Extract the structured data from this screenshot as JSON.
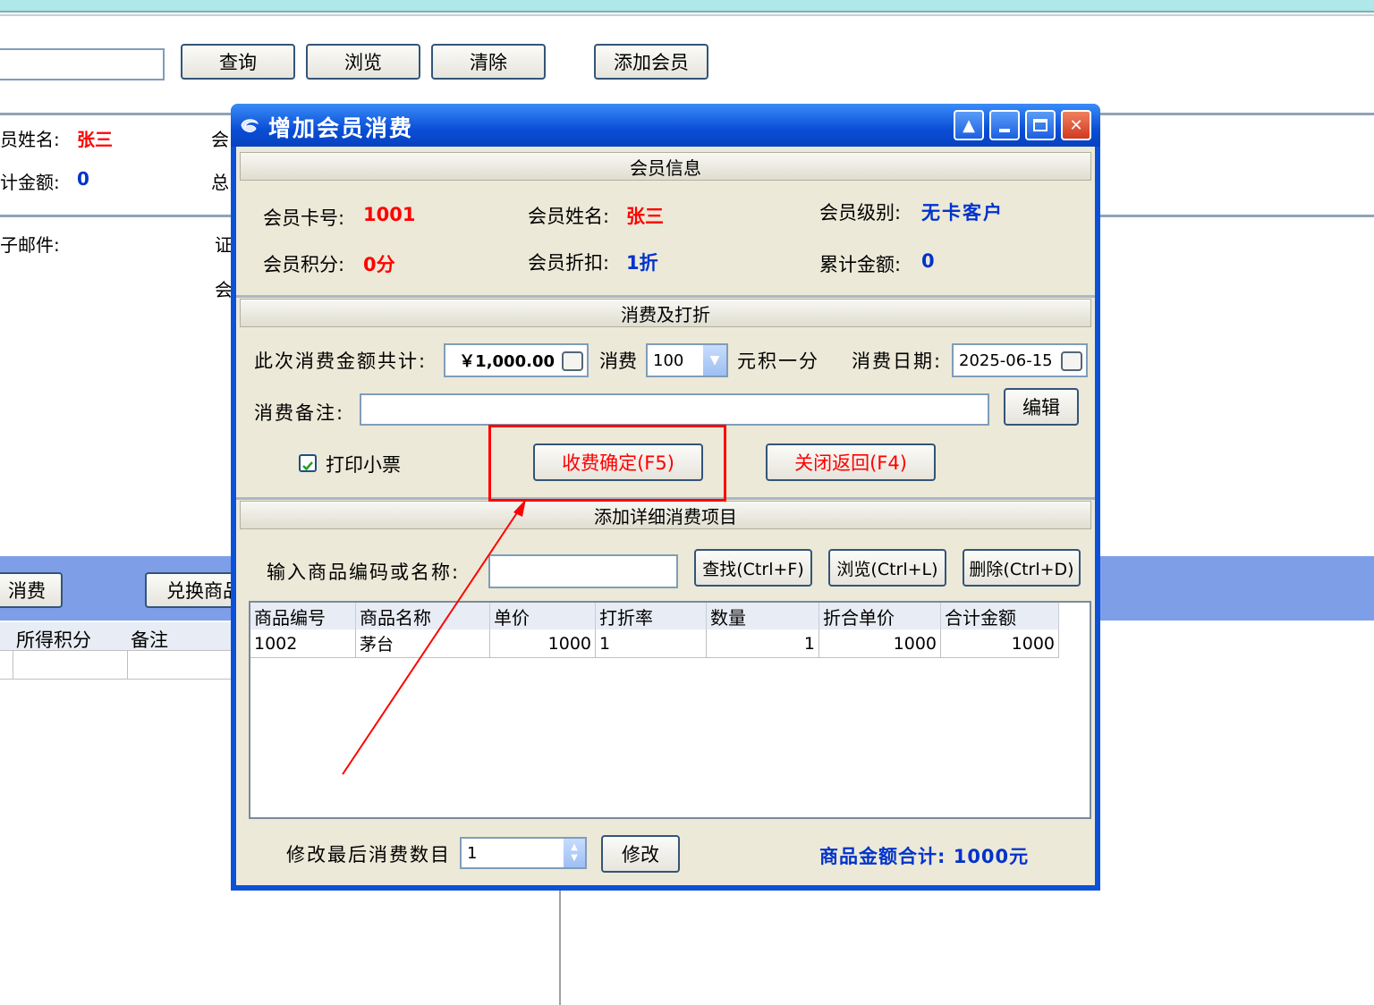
{
  "background": {
    "toolbar": {
      "query": "查询",
      "browse": "浏览",
      "clear": "清除",
      "add_member": "添加会员"
    },
    "info": {
      "name_label": "员姓名:",
      "name_value": "张三",
      "total_label": "计金额:",
      "total_value": "0",
      "email_label": "子邮件:",
      "col2_a": "会",
      "col2_b": "总",
      "col2_c": "证",
      "col2_d": "会"
    },
    "action_bar": {
      "consume": "消费",
      "exchange": "兑换商品"
    },
    "grid_headers": [
      "所得积分",
      "备注"
    ]
  },
  "dialog": {
    "title": "增加会员消费",
    "member_section": {
      "header": "会员信息",
      "card_label": "会员卡号:",
      "card_value": "1001",
      "name_label": "会员姓名:",
      "name_value": "张三",
      "level_label": "会员级别:",
      "level_value": "无卡客户",
      "points_label": "会员积分:",
      "points_value": "0分",
      "discount_label": "会员折扣:",
      "discount_value": "1折",
      "total_label": "累计金额:",
      "total_value": "0"
    },
    "consume_section": {
      "header": "消费及打折",
      "amount_label": "此次消费金额共计:",
      "amount_value": "￥1,000.00",
      "consume_label": "消费",
      "ratio_value": "100",
      "ratio_suffix": "元积一分",
      "date_label": "消费日期:",
      "date_value": "2025-06-15",
      "note_label": "消费备注:",
      "note_value": "",
      "edit_button": "编辑",
      "print_label": "打印小票",
      "print_checked": true,
      "confirm_button": "收费确定(F5)",
      "close_button": "关闭返回(F4)"
    },
    "detail_section": {
      "header": "添加详细消费项目",
      "search_label": "输入商品编码或名称:",
      "search_value": "",
      "find_button": "查找(Ctrl+F)",
      "browse_button": "浏览(Ctrl+L)",
      "delete_button": "删除(Ctrl+D)",
      "columns": [
        "商品编号",
        "商品名称",
        "单价",
        "打折率",
        "数量",
        "折合单价",
        "合计金额"
      ],
      "rows": [
        [
          "1002",
          "茅台",
          "1000",
          "1",
          "1",
          "1000",
          "1000"
        ]
      ],
      "modify_label": "修改最后消费数目",
      "modify_value": "1",
      "modify_button": "修改",
      "sum_text": "商品金额合计: 1000元"
    }
  }
}
